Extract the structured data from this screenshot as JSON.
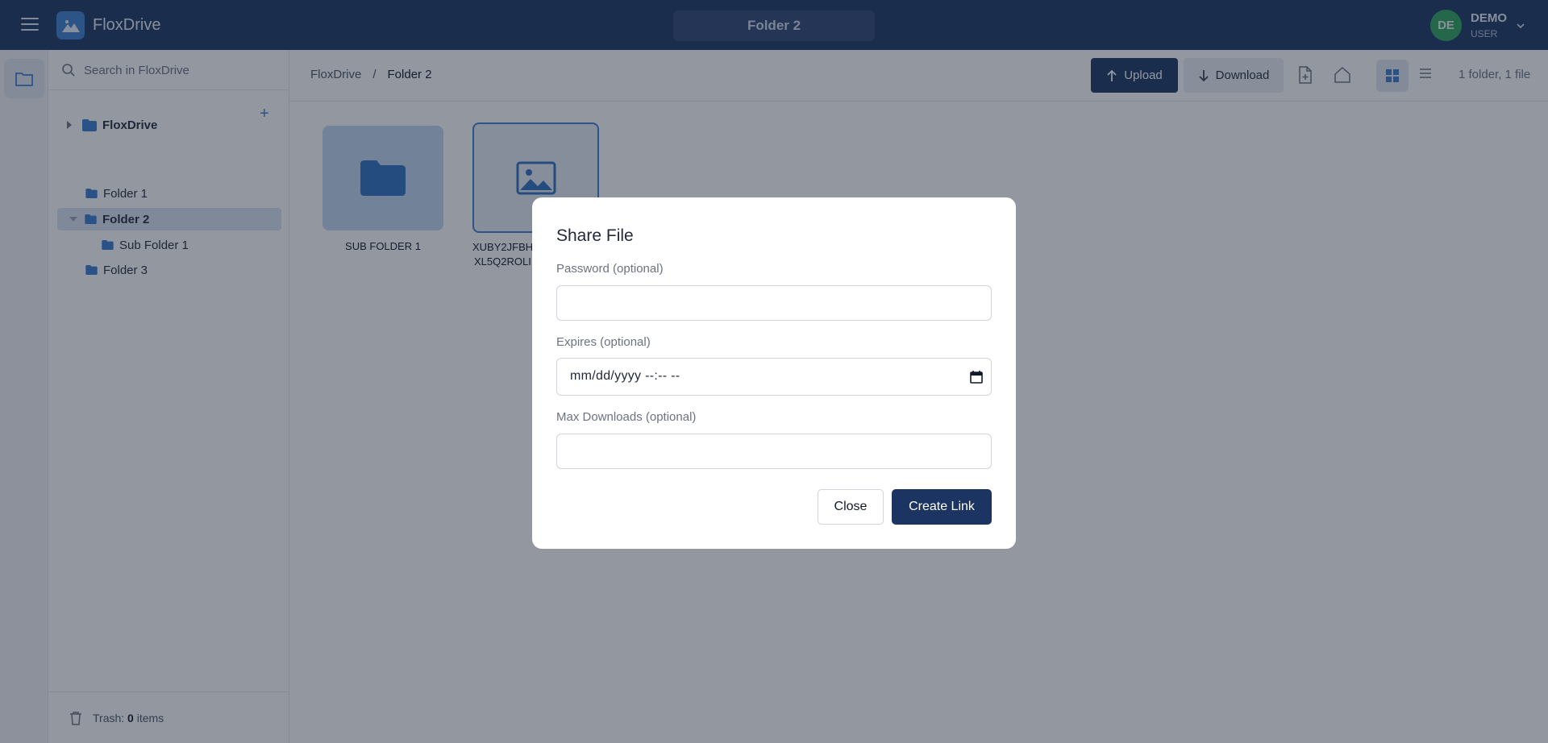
{
  "header": {
    "app_name": "FloxDrive",
    "current_folder": "Folder 2",
    "user_initials": "DE",
    "user_name": "DEMO",
    "user_role": "USER"
  },
  "sidebar": {
    "search_placeholder": "Search in FloxDrive",
    "tree": [
      {
        "label": "FloxDrive",
        "level": 0,
        "expanded": false,
        "selected": false
      },
      {
        "label": "Folder 1",
        "level": 1,
        "expanded": false,
        "selected": false
      },
      {
        "label": "Folder 2",
        "level": 1,
        "expanded": true,
        "selected": true
      },
      {
        "label": "Sub Folder 1",
        "level": 2,
        "expanded": false,
        "selected": false
      },
      {
        "label": "Folder 3",
        "level": 1,
        "expanded": false,
        "selected": false
      }
    ],
    "trash_label": "Trash:",
    "trash_count": "0",
    "trash_unit": "items"
  },
  "main": {
    "breadcrumb": [
      "FloxDrive",
      "Folder 2"
    ],
    "breadcrumb_sep": "/",
    "upload_label": "Upload",
    "download_label": "Download",
    "counts": "1 folder, 1 file",
    "items": [
      {
        "name": "SUB FOLDER 1",
        "type": "folder"
      },
      {
        "name_line1": "XUBY2JFBH",
        "name_line2": "XL5Q2ROLI",
        "type": "image"
      }
    ]
  },
  "modal": {
    "title": "Share File",
    "password_label": "Password (optional)",
    "password_value": "",
    "expires_label": "Expires (optional)",
    "expires_placeholder": "mm/dd/yyyy --:-- --",
    "max_downloads_label": "Max Downloads (optional)",
    "max_downloads_value": "",
    "close_label": "Close",
    "create_label": "Create Link"
  },
  "colors": {
    "primary": "#1b3461",
    "accent": "#3f7fd0",
    "avatar": "#2ea45a"
  }
}
